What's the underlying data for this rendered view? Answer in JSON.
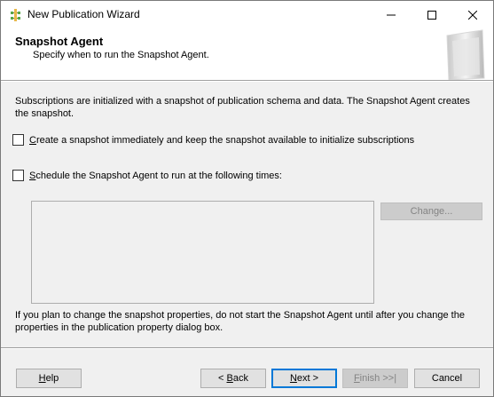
{
  "window": {
    "title": "New Publication Wizard"
  },
  "header": {
    "title": "Snapshot Agent",
    "subtitle": "Specify when to run the Snapshot Agent."
  },
  "body": {
    "intro": "Subscriptions are initialized with a snapshot of publication schema and data. The Snapshot Agent creates the snapshot.",
    "option_create": {
      "prefix": "",
      "hotkey": "C",
      "rest": "reate a snapshot immediately and keep the snapshot available to initialize subscriptions",
      "checked": false
    },
    "option_schedule": {
      "prefix": "",
      "hotkey": "S",
      "rest": "chedule the Snapshot Agent to run at the following times:",
      "checked": false
    },
    "change_button": "Change...",
    "note": "If you plan to change the snapshot properties, do not start the Snapshot Agent until after you change the properties in the publication property dialog box."
  },
  "footer": {
    "help": {
      "hotkey": "H",
      "rest": "elp"
    },
    "back": {
      "prefix": "< ",
      "hotkey": "B",
      "rest": "ack"
    },
    "next": {
      "prefix": "",
      "hotkey": "N",
      "rest": "ext >"
    },
    "finish": {
      "hotkey": "F",
      "rest": "inish >>|"
    },
    "cancel": "Cancel"
  },
  "colors": {
    "accent": "#0078d7",
    "window_bg": "#f0f0f0",
    "disabled_text": "#838383"
  }
}
